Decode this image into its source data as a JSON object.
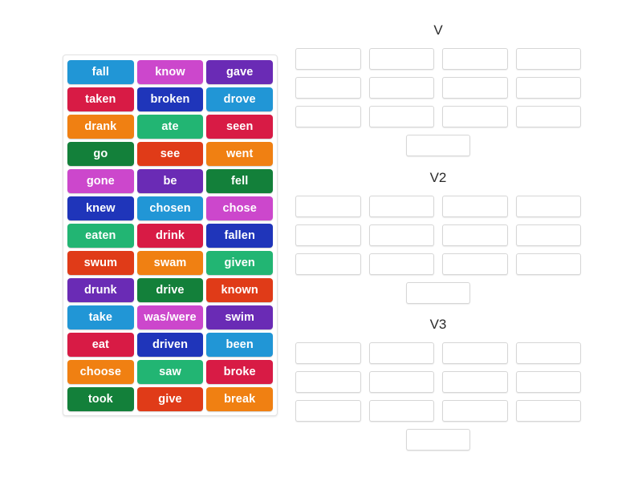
{
  "activity": {
    "type": "drag-and-drop-group-sort",
    "word_bank": {
      "rows": [
        [
          {
            "label": "fall",
            "color": "#2196d6"
          },
          {
            "label": "know",
            "color": "#cc47cc"
          },
          {
            "label": "gave",
            "color": "#6a2bb5"
          }
        ],
        [
          {
            "label": "taken",
            "color": "#d81b45"
          },
          {
            "label": "broken",
            "color": "#1f35ba"
          },
          {
            "label": "drove",
            "color": "#2196d6"
          }
        ],
        [
          {
            "label": "drank",
            "color": "#f08012"
          },
          {
            "label": "ate",
            "color": "#22b573"
          },
          {
            "label": "seen",
            "color": "#d81b45"
          }
        ],
        [
          {
            "label": "go",
            "color": "#13803a"
          },
          {
            "label": "see",
            "color": "#e03b18"
          },
          {
            "label": "went",
            "color": "#f08012"
          }
        ],
        [
          {
            "label": "gone",
            "color": "#cc47cc"
          },
          {
            "label": "be",
            "color": "#6a2bb5"
          },
          {
            "label": "fell",
            "color": "#13803a"
          }
        ],
        [
          {
            "label": "knew",
            "color": "#1f35ba"
          },
          {
            "label": "chosen",
            "color": "#2196d6"
          },
          {
            "label": "chose",
            "color": "#cc47cc"
          }
        ],
        [
          {
            "label": "eaten",
            "color": "#22b573"
          },
          {
            "label": "drink",
            "color": "#d81b45"
          },
          {
            "label": "fallen",
            "color": "#1f35ba"
          }
        ],
        [
          {
            "label": "swum",
            "color": "#e03b18"
          },
          {
            "label": "swam",
            "color": "#f08012"
          },
          {
            "label": "given",
            "color": "#22b573"
          }
        ],
        [
          {
            "label": "drunk",
            "color": "#6a2bb5"
          },
          {
            "label": "drive",
            "color": "#13803a"
          },
          {
            "label": "known",
            "color": "#e03b18"
          }
        ],
        [
          {
            "label": "take",
            "color": "#2196d6"
          },
          {
            "label": "was/were",
            "color": "#cc47cc"
          },
          {
            "label": "swim",
            "color": "#6a2bb5"
          }
        ],
        [
          {
            "label": "eat",
            "color": "#d81b45"
          },
          {
            "label": "driven",
            "color": "#1f35ba"
          },
          {
            "label": "been",
            "color": "#2196d6"
          }
        ],
        [
          {
            "label": "choose",
            "color": "#f08012"
          },
          {
            "label": "saw",
            "color": "#22b573"
          },
          {
            "label": "broke",
            "color": "#d81b45"
          }
        ],
        [
          {
            "label": "took",
            "color": "#13803a"
          },
          {
            "label": "give",
            "color": "#e03b18"
          },
          {
            "label": "break",
            "color": "#f08012"
          }
        ]
      ]
    },
    "groups": [
      {
        "title": "V",
        "slot_count": 13,
        "slots": [
          "",
          "",
          "",
          "",
          "",
          "",
          "",
          "",
          "",
          "",
          "",
          "",
          ""
        ]
      },
      {
        "title": "V2",
        "slot_count": 13,
        "slots": [
          "",
          "",
          "",
          "",
          "",
          "",
          "",
          "",
          "",
          "",
          "",
          "",
          ""
        ]
      },
      {
        "title": "V3",
        "slot_count": 13,
        "slots": [
          "",
          "",
          "",
          "",
          "",
          "",
          "",
          "",
          "",
          "",
          "",
          "",
          ""
        ]
      }
    ]
  },
  "theme": {
    "page_background": "#ffffff",
    "panel_border": "#e2e2e2",
    "slot_border": "#d6d6d6",
    "title_color": "#2a2a2a",
    "tile_text_color": "#ffffff"
  }
}
